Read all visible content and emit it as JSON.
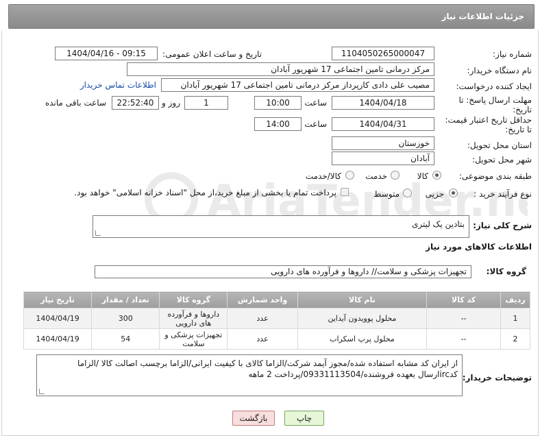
{
  "header": {
    "title": "جزئیات اطلاعات نیاز"
  },
  "form": {
    "need_number": {
      "label": "شماره نیاز:",
      "value": "1104050265000047"
    },
    "announce_datetime": {
      "label": "تاریخ و ساعت اعلان عمومی:",
      "value": "1404/04/16 - 09:15"
    },
    "buyer_org": {
      "label": "نام دستگاه خریدار:",
      "value": "مرکز درمانی تامین اجتماعی 17 شهریور آبادان"
    },
    "requester": {
      "label": "ایجاد کننده درخواست:",
      "value": "مصیب علی دادی کارپرداز مرکز درمانی تامین اجتماعی 17 شهریور آبادان"
    },
    "contact_link": "اطلاعات تماس خریدار",
    "deadline": {
      "label_line1": "مهلت ارسال پاسخ: تا",
      "label_line2": "تاریخ:",
      "date": "1404/04/18",
      "time_label": "ساعت",
      "time": "10:00",
      "days": "1",
      "days_label": "روز و",
      "remaining": "22:52:40",
      "remaining_label": "ساعت باقی مانده"
    },
    "price_validity": {
      "label_line1": "حداقل تاریخ اعتبار قیمت:",
      "label_line2": "تا تاریخ:",
      "date": "1404/04/31",
      "time_label": "ساعت",
      "time": "14:00"
    },
    "province": {
      "label": "استان محل تحویل:",
      "value": "خوزستان"
    },
    "city": {
      "label": "شهر محل تحویل:",
      "value": "آبادان"
    },
    "category": {
      "label": "طبقه بندی موضوعی:",
      "options": [
        "کالا",
        "خدمت",
        "کالا/خدمت"
      ],
      "selected": "کالا"
    },
    "purchase_type": {
      "label": "نوع فرآیند خرید :",
      "options": [
        "جزیی",
        "متوسط"
      ],
      "selected": "جزیی",
      "payment_note": "پرداخت تمام یا بخشی از مبلغ خرید،از محل \"اسناد خزانه اسلامی\" خواهد بود."
    }
  },
  "summary": {
    "label": "شرح کلی نیاز:",
    "value": "بتادین یک لیتری"
  },
  "items_section": {
    "title": "اطلاعات کالاهای مورد نیاز"
  },
  "goods_group": {
    "label": "گروه کالا:",
    "value": "تجهیزات پزشکی و سلامت// داروها و فرآورده های دارویی"
  },
  "table": {
    "headers": [
      "ردیف",
      "کد کالا",
      "نام کالا",
      "واحد شمارش",
      "گروه کالا",
      "تعداد / مقدار",
      "تاریخ نیاز"
    ],
    "rows": [
      [
        "1",
        "--",
        "محلول پوویدون آیداین",
        "عدد",
        "داروها و فرآورده های دارویی",
        "300",
        "1404/04/19"
      ],
      [
        "2",
        "--",
        "محلول پرپ اسکراب",
        "عدد",
        "تجهیزات پزشکی و سلامت",
        "54",
        "1404/04/19"
      ]
    ]
  },
  "buyer_notes": {
    "label": "توضیحات خریدار:",
    "value": "از ایران کد مشابه استفاده شده/مجوز آیمد شرکت/الزاما کالای با کیفیت ایرانی/الزاما برچسب اصالت کالا /الزاما کدircارسال بعهده فروشنده/09331113504/پرداخت 2 ماهه"
  },
  "buttons": {
    "print": "چاپ",
    "back": "بازگشت"
  },
  "watermark": {
    "text": "AriaTender.neT"
  }
}
